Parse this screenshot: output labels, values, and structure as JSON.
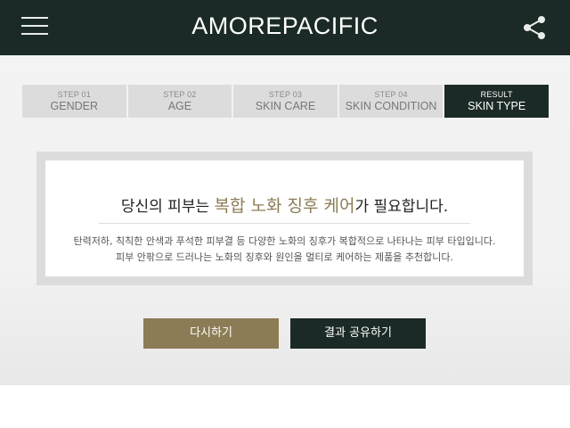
{
  "header": {
    "logo": "AMOREPACIFIC",
    "menu_icon": "hamburger-menu-icon",
    "share_icon": "share-icon",
    "background": "#1b2a26"
  },
  "steps": [
    {
      "num": "STEP 01",
      "label": "GENDER"
    },
    {
      "num": "STEP 02",
      "label": "AGE"
    },
    {
      "num": "STEP 03",
      "label": "SKIN CARE"
    },
    {
      "num": "STEP 04",
      "label": "SKIN CONDITION"
    },
    {
      "num": "RESULT",
      "label": "SKIN TYPE"
    }
  ],
  "result": {
    "headline_prefix": "당신의 피부는 ",
    "headline_highlight": "복합 노화 징후 케어",
    "headline_suffix": "가 필요합니다.",
    "line1": "탄력저하, 칙칙한 안색과 푸석한 피부결 등 다양한 노화의 징후가 복합적으로 나타나는 피부 타입입니다.",
    "line2": "피부 안팎으로 드러나는 노화의 징후와 원인을 멀티로 케어하는 제품을 추천합니다.",
    "highlight_color": "#8c7c55"
  },
  "buttons": {
    "retry": "다시하기",
    "share": "결과 공유하기"
  }
}
